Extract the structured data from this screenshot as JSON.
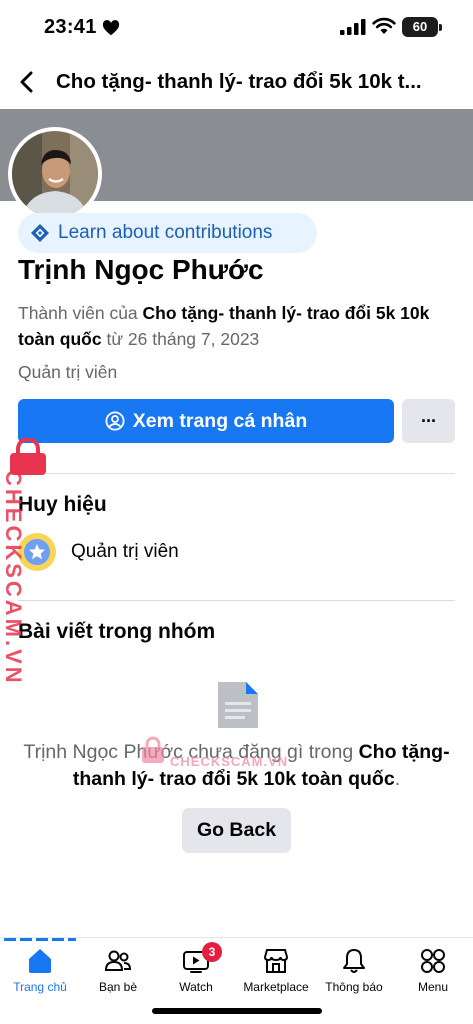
{
  "status_bar": {
    "time": "23:41",
    "battery": "60"
  },
  "header": {
    "title": "Cho tặng- thanh lý- trao đổi 5k 10k t..."
  },
  "profile": {
    "contributions_label": "Learn about contributions",
    "name": "Trịnh Ngọc Phước",
    "member_prefix": "Thành viên của",
    "group_name": "Cho tặng- thanh lý- trao đổi 5k 10k toàn quốc",
    "member_suffix": "từ 26 tháng 7, 2023",
    "role": "Quản trị viên",
    "view_profile_label": "Xem trang cá nhân",
    "more_label": "···"
  },
  "badges": {
    "title": "Huy hiệu",
    "items": [
      {
        "label": "Quản trị viên"
      }
    ]
  },
  "posts": {
    "title": "Bài viết trong nhóm",
    "empty_prefix": "Trịnh Ngọc Phước chưa đăng gì trong",
    "empty_group": "Cho tặng- thanh lý- trao đổi 5k 10k toàn quốc",
    "empty_suffix": ".",
    "go_back_label": "Go Back"
  },
  "watermark": {
    "vertical": "CHECKSCAM.VN",
    "center": "CHECKSCAM.VN"
  },
  "tabbar": {
    "items": [
      {
        "label": "Trang chủ",
        "icon": "home-icon",
        "active": true
      },
      {
        "label": "Bạn bè",
        "icon": "friends-icon"
      },
      {
        "label": "Watch",
        "icon": "watch-icon",
        "badge": "3"
      },
      {
        "label": "Marketplace",
        "icon": "marketplace-icon"
      },
      {
        "label": "Thông báo",
        "icon": "bell-icon"
      },
      {
        "label": "Menu",
        "icon": "menu-grid-icon"
      }
    ]
  },
  "colors": {
    "accent": "#1877f2",
    "cover": "#8a8d91",
    "chip_bg": "#e7f3ff",
    "badge_red": "#e41e3f"
  }
}
